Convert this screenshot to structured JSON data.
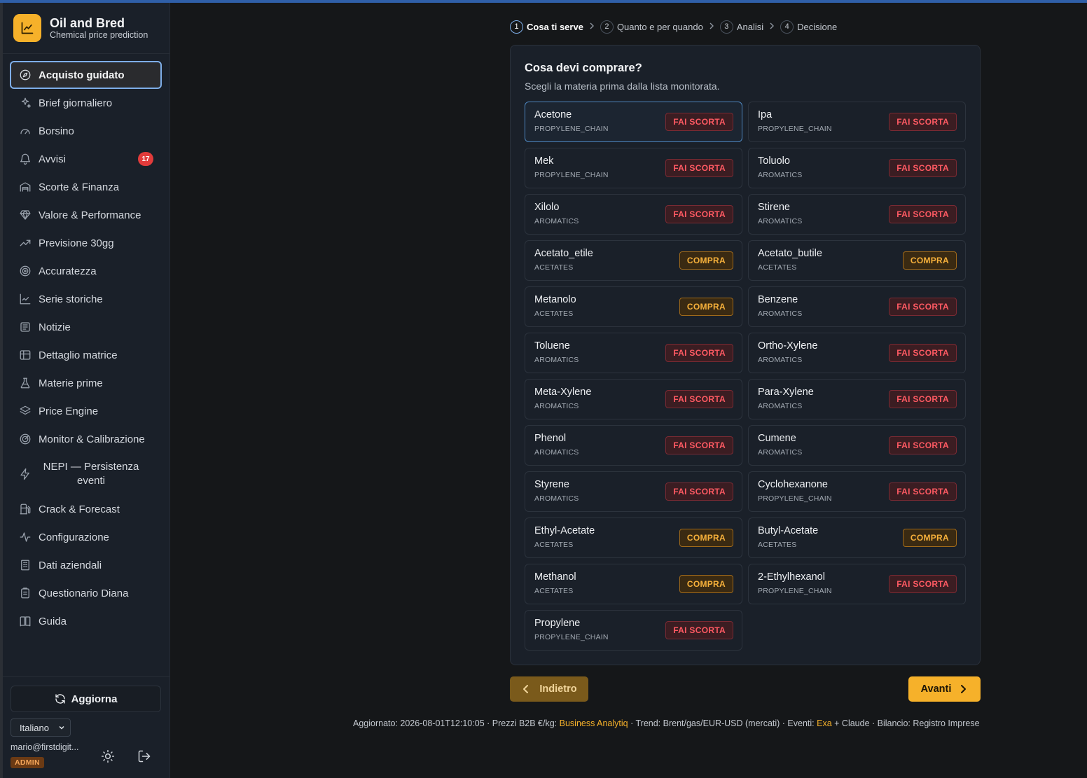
{
  "app": {
    "title": "Oil and Bred",
    "subtitle": "Chemical price prediction"
  },
  "sidebar": {
    "items": [
      {
        "label": "Acquisto guidato",
        "icon": "compass-icon",
        "active": true
      },
      {
        "label": "Brief giornaliero",
        "icon": "sparkles-icon"
      },
      {
        "label": "Borsino",
        "icon": "gauge-icon"
      },
      {
        "label": "Avvisi",
        "icon": "bell-icon",
        "badge": "17"
      },
      {
        "label": "Scorte & Finanza",
        "icon": "warehouse-icon"
      },
      {
        "label": "Valore & Performance",
        "icon": "gem-icon"
      },
      {
        "label": "Previsione 30gg",
        "icon": "trend-up-icon"
      },
      {
        "label": "Accuratezza",
        "icon": "target-icon"
      },
      {
        "label": "Serie storiche",
        "icon": "chart-line-icon"
      },
      {
        "label": "Notizie",
        "icon": "newspaper-icon"
      },
      {
        "label": "Dettaglio matrice",
        "icon": "table-icon"
      },
      {
        "label": "Materie prime",
        "icon": "flask-icon"
      },
      {
        "label": "Price Engine",
        "icon": "layers-icon"
      },
      {
        "label": "Monitor & Calibrazione",
        "icon": "radar-icon"
      },
      {
        "label": "NEPI — Persistenza eventi",
        "icon": "zap-icon",
        "tall": true
      },
      {
        "label": "Crack & Forecast",
        "icon": "fuel-icon"
      },
      {
        "label": "Configurazione",
        "icon": "activity-icon"
      },
      {
        "label": "Dati aziendali",
        "icon": "building-icon"
      },
      {
        "label": "Questionario Diana",
        "icon": "clipboard-icon"
      },
      {
        "label": "Guida",
        "icon": "book-icon"
      }
    ],
    "refresh_label": "Aggiorna",
    "language": "Italiano",
    "user_email": "mario@firstdigit...",
    "role": "ADMIN"
  },
  "stepper": [
    {
      "num": "1",
      "label": "Cosa ti serve",
      "active": true
    },
    {
      "num": "2",
      "label": "Quanto e per quando"
    },
    {
      "num": "3",
      "label": "Analisi"
    },
    {
      "num": "4",
      "label": "Decisione"
    }
  ],
  "panel": {
    "title": "Cosa devi comprare?",
    "subtitle": "Scegli la materia prima dalla lista monitorata."
  },
  "materials": [
    {
      "name": "Acetone",
      "group": "PROPYLENE_CHAIN",
      "signal": "FAI SCORTA",
      "kind": "stock",
      "selected": true
    },
    {
      "name": "Ipa",
      "group": "PROPYLENE_CHAIN",
      "signal": "FAI SCORTA",
      "kind": "stock"
    },
    {
      "name": "Mek",
      "group": "PROPYLENE_CHAIN",
      "signal": "FAI SCORTA",
      "kind": "stock"
    },
    {
      "name": "Toluolo",
      "group": "AROMATICS",
      "signal": "FAI SCORTA",
      "kind": "stock"
    },
    {
      "name": "Xilolo",
      "group": "AROMATICS",
      "signal": "FAI SCORTA",
      "kind": "stock"
    },
    {
      "name": "Stirene",
      "group": "AROMATICS",
      "signal": "FAI SCORTA",
      "kind": "stock"
    },
    {
      "name": "Acetato_etile",
      "group": "ACETATES",
      "signal": "COMPRA",
      "kind": "buy"
    },
    {
      "name": "Acetato_butile",
      "group": "ACETATES",
      "signal": "COMPRA",
      "kind": "buy"
    },
    {
      "name": "Metanolo",
      "group": "ACETATES",
      "signal": "COMPRA",
      "kind": "buy"
    },
    {
      "name": "Benzene",
      "group": "AROMATICS",
      "signal": "FAI SCORTA",
      "kind": "stock"
    },
    {
      "name": "Toluene",
      "group": "AROMATICS",
      "signal": "FAI SCORTA",
      "kind": "stock"
    },
    {
      "name": "Ortho-Xylene",
      "group": "AROMATICS",
      "signal": "FAI SCORTA",
      "kind": "stock"
    },
    {
      "name": "Meta-Xylene",
      "group": "AROMATICS",
      "signal": "FAI SCORTA",
      "kind": "stock"
    },
    {
      "name": "Para-Xylene",
      "group": "AROMATICS",
      "signal": "FAI SCORTA",
      "kind": "stock"
    },
    {
      "name": "Phenol",
      "group": "AROMATICS",
      "signal": "FAI SCORTA",
      "kind": "stock"
    },
    {
      "name": "Cumene",
      "group": "AROMATICS",
      "signal": "FAI SCORTA",
      "kind": "stock"
    },
    {
      "name": "Styrene",
      "group": "AROMATICS",
      "signal": "FAI SCORTA",
      "kind": "stock"
    },
    {
      "name": "Cyclohexanone",
      "group": "PROPYLENE_CHAIN",
      "signal": "FAI SCORTA",
      "kind": "stock"
    },
    {
      "name": "Ethyl-Acetate",
      "group": "ACETATES",
      "signal": "COMPRA",
      "kind": "buy"
    },
    {
      "name": "Butyl-Acetate",
      "group": "ACETATES",
      "signal": "COMPRA",
      "kind": "buy"
    },
    {
      "name": "Methanol",
      "group": "ACETATES",
      "signal": "COMPRA",
      "kind": "buy"
    },
    {
      "name": "2-Ethylhexanol",
      "group": "PROPYLENE_CHAIN",
      "signal": "FAI SCORTA",
      "kind": "stock"
    },
    {
      "name": "Propylene",
      "group": "PROPYLENE_CHAIN",
      "signal": "FAI SCORTA",
      "kind": "stock"
    }
  ],
  "nav_buttons": {
    "back": "Indietro",
    "next": "Avanti"
  },
  "footer": {
    "part1": "Aggiornato: 2026-08-01T12:10:05 · Prezzi B2B €/kg: ",
    "link1": "Business Analytiq",
    "part2": " · Trend: Brent/gas/EUR-USD (mercati) · Eventi: ",
    "link2": "Exa",
    "part3": " + Claude · Bilancio: Registro Imprese"
  },
  "colors": {
    "accent": "#f6b12a",
    "stock": "#ff5a63",
    "buy": "#f7b13b",
    "focus": "#7eaee8"
  }
}
